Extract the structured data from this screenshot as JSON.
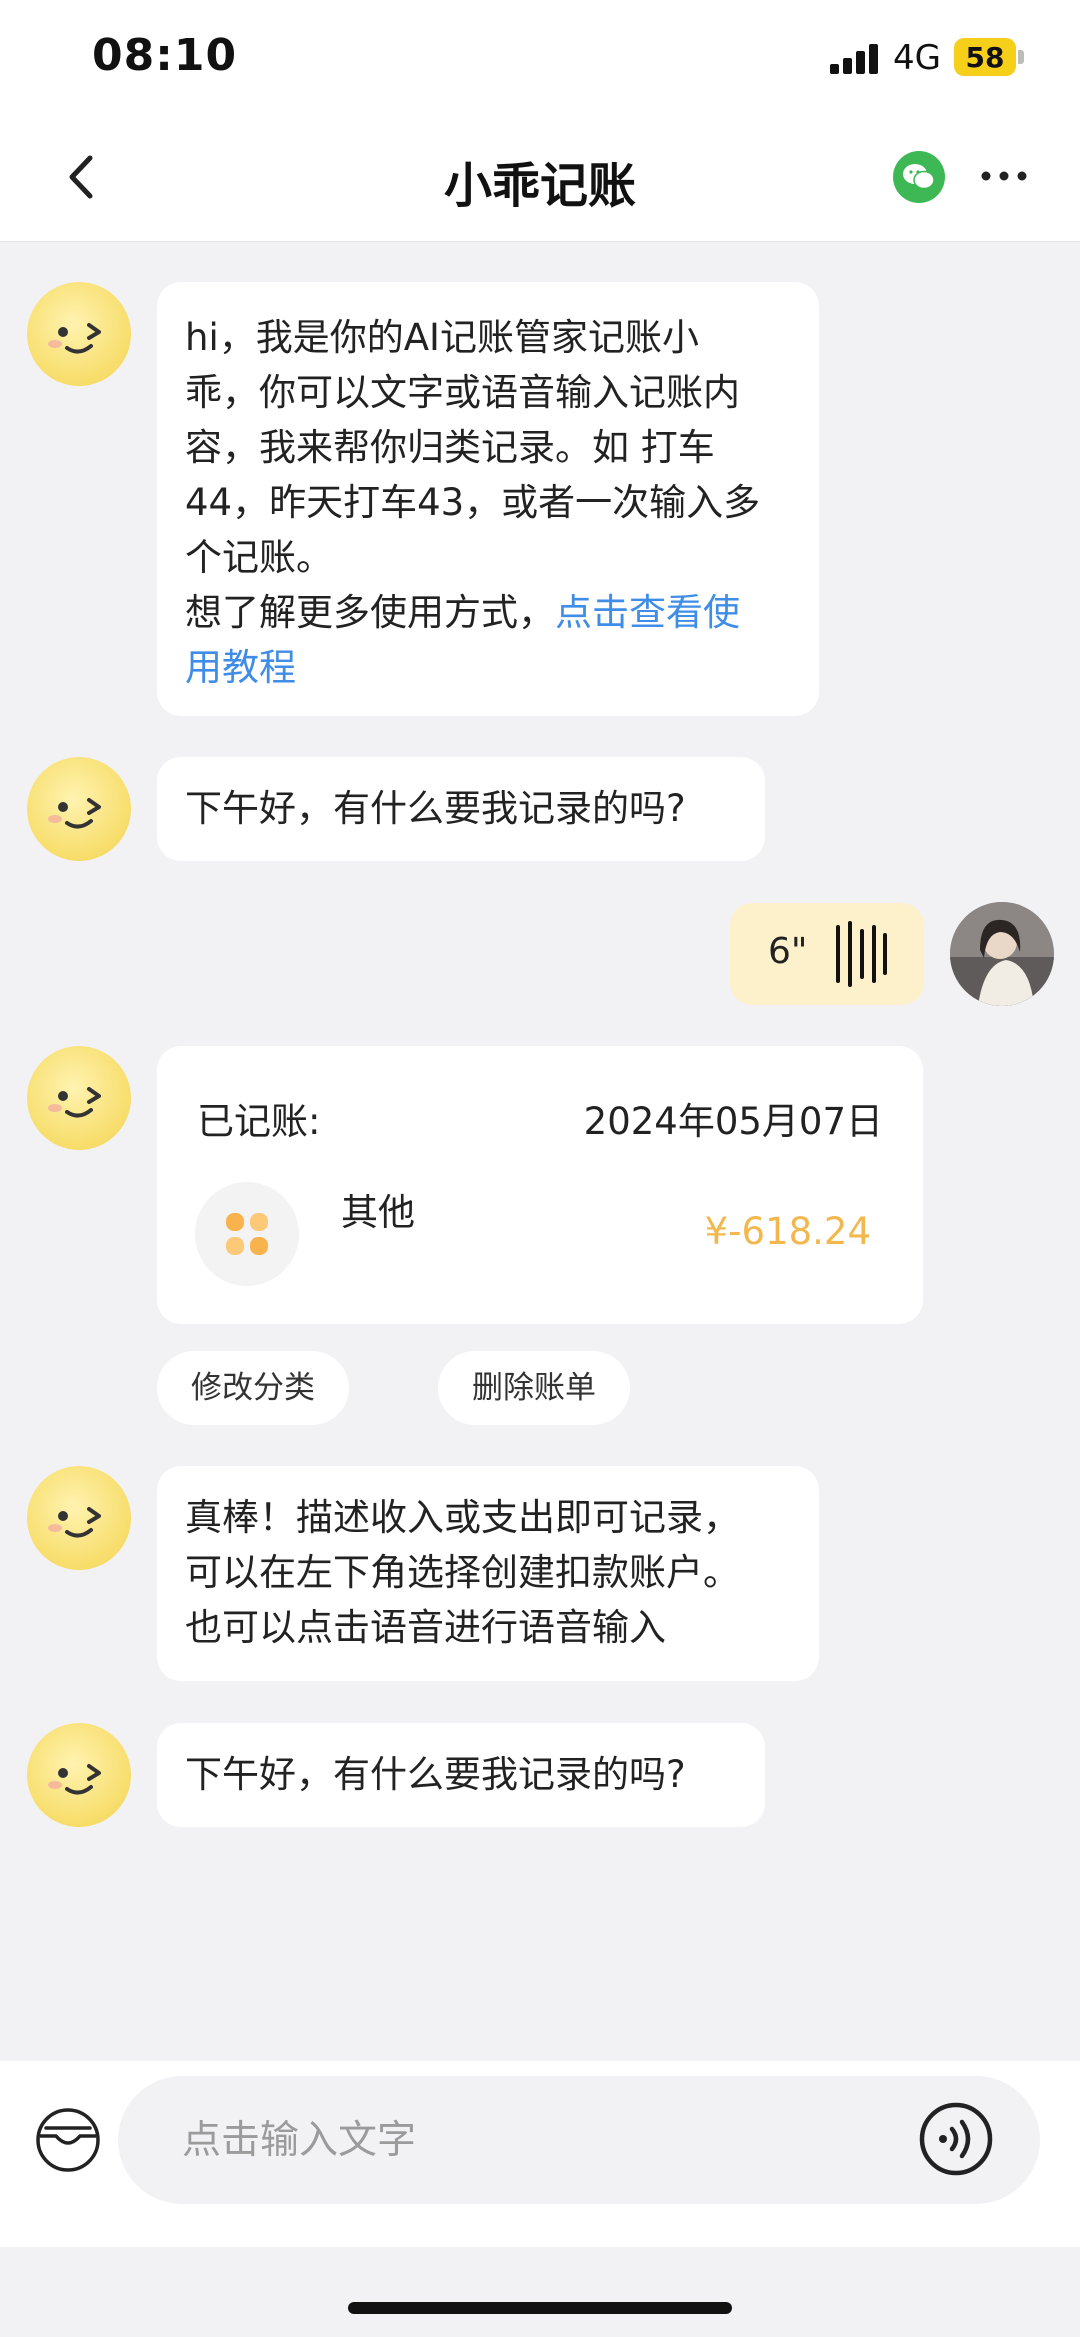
{
  "status_bar": {
    "time": "08:10",
    "network": "4G",
    "battery": "58"
  },
  "header": {
    "title": "小乖记账"
  },
  "messages": {
    "intro_lines": [
      "hi，我是你的AI记账管家记账小",
      "乖，你可以文字或语音输入记账内",
      "容，我来帮你归类记录。如 打车",
      "44，昨天打车43，或者一次输入多",
      "个记账。"
    ],
    "intro_more": "想了解更多使用方式，",
    "intro_link_line1": "点击查看使",
    "intro_link_line2": "用教程",
    "greeting": "下午好，有什么要我记录的吗?",
    "voice_duration": "6\"",
    "tip_lines": [
      "真棒！描述收入或支出即可记录，",
      "可以在左下角选择创建扣款账户。",
      "也可以点击语音进行语音输入"
    ],
    "greeting2": "下午好，有什么要我记录的吗?"
  },
  "record": {
    "label": "已记账:",
    "date": "2024年05月07日",
    "category": "其他",
    "amount": "¥-618.24"
  },
  "actions": {
    "edit": "修改分类",
    "delete": "删除账单"
  },
  "input": {
    "placeholder": "点击输入文字"
  },
  "colors": {
    "accent_link": "#3f8de6",
    "amount": "#f2b84d",
    "voice_bubble": "#fdf1cb",
    "wechat": "#3db854"
  },
  "icons": [
    "back-icon",
    "wechat-icon",
    "more-icon",
    "wallet-icon",
    "voice-input-icon",
    "category-other-icon",
    "voice-wave-icon"
  ]
}
